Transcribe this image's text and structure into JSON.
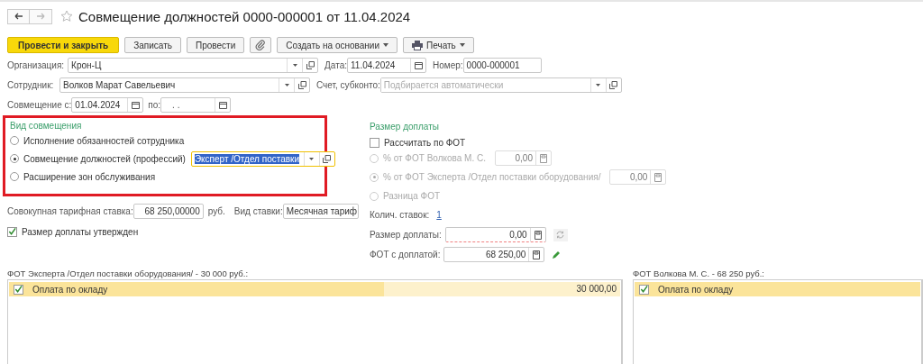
{
  "window": {
    "title": "Совмещение должностей 0000-000001 от 11.04.2024",
    "favorite": false
  },
  "toolbar": [
    {
      "kind": "primary",
      "label": "Провести и закрыть"
    },
    {
      "kind": "plain",
      "label": "Записать"
    },
    {
      "kind": "plain",
      "label": "Провести"
    },
    {
      "kind": "attach"
    },
    {
      "kind": "menu",
      "label": "Создать на основании"
    },
    {
      "kind": "print",
      "label": "Печать"
    }
  ],
  "header": {
    "organization": {
      "label": "Организация:",
      "value": "Крон-Ц"
    },
    "date": {
      "label": "Дата:",
      "value": "11.04.2024"
    },
    "number": {
      "label": "Номер:",
      "value": "0000-000001"
    },
    "employee": {
      "label": "Сотрудник:",
      "value": "Волков Марат Савельевич"
    },
    "account": {
      "label": "Счет, субконто:",
      "placeholder": "Подбирается автоматически"
    },
    "from": {
      "label": "Совмещение с:",
      "value": "01.04.2024"
    },
    "to": {
      "label": "по:",
      "value": ". ."
    }
  },
  "combination_type": {
    "title": "Вид совмещения",
    "options": [
      {
        "label": "Исполнение обязанностей сотрудника",
        "selected": false
      },
      {
        "label": "Совмещение должностей (профессий)",
        "selected": true,
        "position": "Эксперт /Отдел поставки"
      },
      {
        "label": "Расширение зон обслуживания",
        "selected": false
      }
    ]
  },
  "surcharge": {
    "title": "Размер доплаты",
    "calc_by_fot": {
      "label": "Рассчитать по ФОТ",
      "checked": false
    },
    "options": [
      {
        "label": "% от ФОТ Волкова М. С.",
        "selected": false,
        "disabled": true,
        "value": "0,00"
      },
      {
        "label": "% от ФОТ Эксперта /Отдел поставки оборудования/",
        "selected": true,
        "disabled": true,
        "value": "0,00"
      },
      {
        "label": "Разница ФОТ",
        "selected": false,
        "disabled": true
      }
    ],
    "rate_count": {
      "label": "Колич. ставок:",
      "value": "1"
    },
    "amount": {
      "label": "Размер доплаты:",
      "value": "0,00",
      "invalid": true
    },
    "fot_total": {
      "label": "ФОТ с доплатой:",
      "value": "68 250,00"
    }
  },
  "rate": {
    "label": "Совокупная тарифная ставка:",
    "value": "68 250,00000",
    "unit": "руб.",
    "type_label": "Вид ставки:",
    "type_value": "Месячная тариф"
  },
  "approved": {
    "label": "Размер доплаты утвержден",
    "checked": true
  },
  "tables": [
    {
      "title": "ФОТ Эксперта /Отдел поставки оборудования/ - 30 000 руб.:",
      "rows": [
        {
          "checked": true,
          "name": "Оплата по окладу",
          "amount": "30 000,00"
        }
      ]
    },
    {
      "title": "ФОТ Волкова М. С. - 68 250 руб.:",
      "rows": [
        {
          "checked": true,
          "name": "Оплата по окладу"
        }
      ]
    }
  ]
}
